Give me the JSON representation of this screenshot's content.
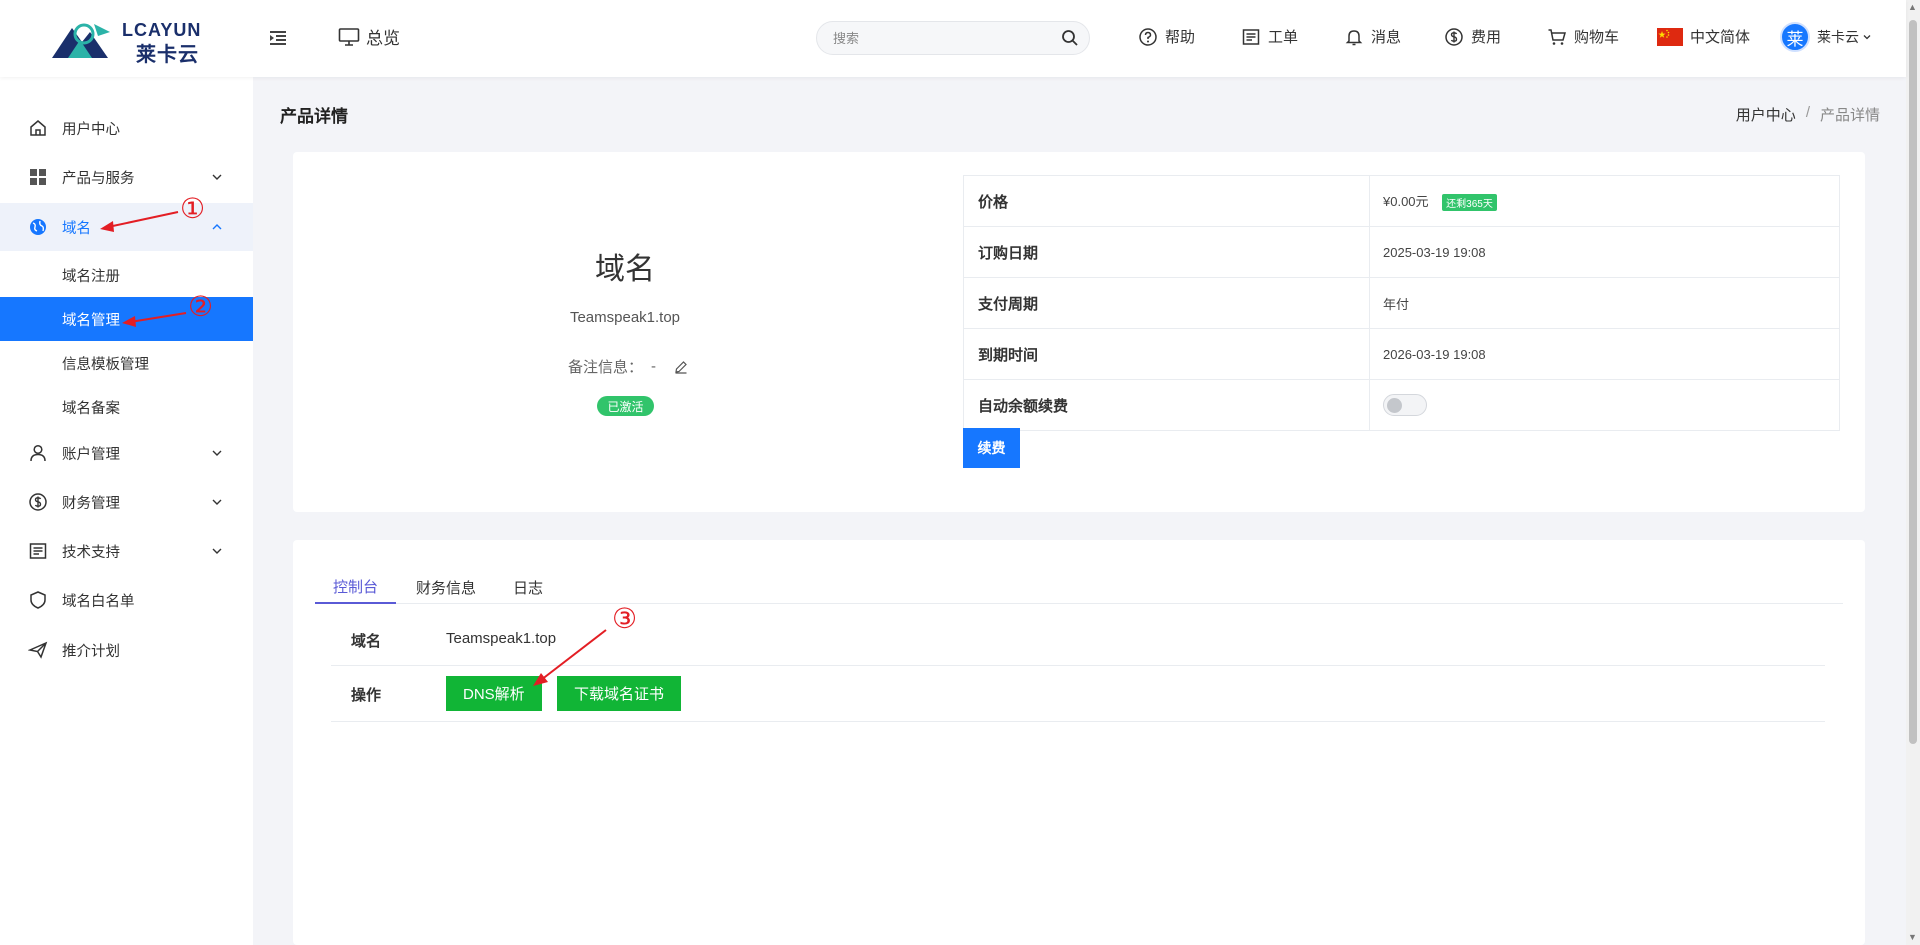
{
  "header": {
    "logo_en": "LCAYUN",
    "logo_cn": "莱卡云",
    "overview": "总览",
    "search_placeholder": "搜索",
    "nav": {
      "help": "帮助",
      "ticket": "工单",
      "message": "消息",
      "cost": "费用",
      "cart": "购物车",
      "language": "中文简体",
      "user_avatar": "莱",
      "user_name": "莱卡云"
    }
  },
  "sidebar": {
    "items": [
      {
        "label": "用户中心",
        "icon": "home-icon"
      },
      {
        "label": "产品与服务",
        "icon": "grid-icon"
      },
      {
        "label": "域名",
        "icon": "globe-icon"
      },
      {
        "label": "账户管理",
        "icon": "user-icon"
      },
      {
        "label": "财务管理",
        "icon": "dollar-icon"
      },
      {
        "label": "技术支持",
        "icon": "document-icon"
      },
      {
        "label": "域名白名单",
        "icon": "shield-icon"
      },
      {
        "label": "推介计划",
        "icon": "send-icon"
      }
    ],
    "domain_sub": [
      {
        "label": "域名注册"
      },
      {
        "label": "域名管理"
      },
      {
        "label": "信息模板管理"
      },
      {
        "label": "域名备案"
      }
    ]
  },
  "page": {
    "title": "产品详情",
    "breadcrumb": [
      "用户中心",
      "/",
      "产品详情"
    ]
  },
  "product": {
    "name": "域名",
    "domain": "Teamspeak1.top",
    "note_label": "备注信息：",
    "note_value": "-",
    "status": "已激活",
    "info": [
      {
        "k": "价格",
        "v": "¥0.00元",
        "tag": "还剩365天"
      },
      {
        "k": "订购日期",
        "v": "2025-03-19 19:08"
      },
      {
        "k": "支付周期",
        "v": "年付"
      },
      {
        "k": "到期时间",
        "v": "2026-03-19 19:08"
      },
      {
        "k": "自动余额续费",
        "v": ""
      }
    ],
    "renew_button": "续费"
  },
  "tabs": [
    {
      "label": "控制台"
    },
    {
      "label": "财务信息"
    },
    {
      "label": "日志"
    }
  ],
  "console": {
    "domain_label": "域名",
    "domain_value": "Teamspeak1.top",
    "action_label": "操作",
    "dns_button": "DNS解析",
    "cert_button": "下载域名证书"
  },
  "annotations": [
    "①",
    "②",
    "③"
  ],
  "colors": {
    "primary": "#1677ff",
    "success": "#11b536",
    "active_badge": "#31c46b",
    "annotation": "#e31e24",
    "tab_active": "#5a5ad6"
  }
}
